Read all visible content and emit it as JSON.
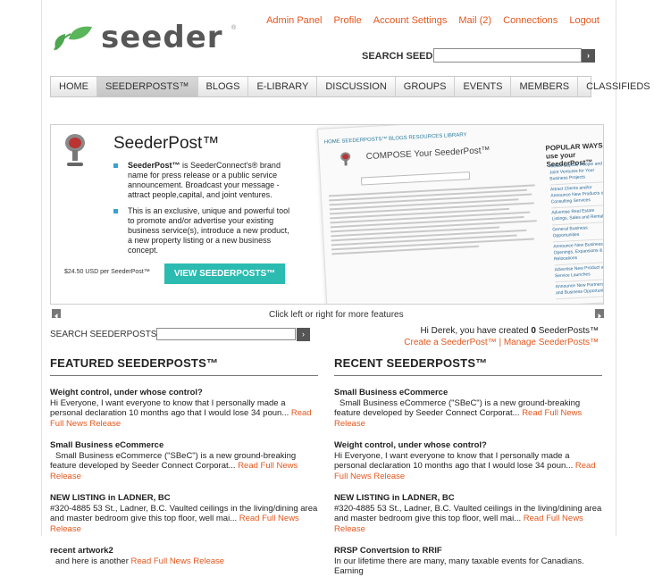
{
  "top_links": [
    "Admin Panel",
    "Profile",
    "Account Settings",
    "Mail (2)",
    "Connections",
    "Logout"
  ],
  "logo": {
    "text": "seeder",
    "reg": "®"
  },
  "search_top": {
    "label": "SEARCH SEEDER:",
    "button": "›"
  },
  "nav": [
    "HOME",
    "SEEDERPOSTS™",
    "BLOGS",
    "E-LIBRARY",
    "DISCUSSION",
    "GROUPS",
    "EVENTS",
    "MEMBERS",
    "CLASSIFIEDS"
  ],
  "banner": {
    "title": "SeederPost™",
    "bullet1_bold": "SeederPost™",
    "bullet1_rest": " is SeederConnect's® brand name for press release or a public service announcement. Broadcast your message - attract people,capital, and joint ventures.",
    "bullet2": "This is an exclusive, unique and powerful tool to promote and/or advertise your existing business service(s), introduce a new product, a new property listing or a new business concept.",
    "price": "$24.50 USD per SeederPost™",
    "button": "VIEW SEEDERPOSTS™",
    "preview_compose": "COMPOSE Your SeederPost™",
    "preview_popular": "POPULAR WAYS to use your SeederPost™",
    "preview_nav": "HOME   SEEDERPOSTS™   BLOGS   RESOURCES   LIBRARY",
    "preview_items": [
      "Attract Capital, People and Joint Ventures for Your Business Projects",
      "Attract Clients and/or Announce New Products or Consulting Services",
      "Advertise Real Estate Listings, Sales and Rentals",
      "General Business Opportunities",
      "Announce New Business Openings, Expansions & Relocations",
      "Advertise New Product and Service Launches",
      "Announce New Partnerships and Business Opportunities"
    ]
  },
  "click_note": "Click left or right for more features",
  "search2": {
    "label": "SEARCH SEEDERPOSTS:",
    "button": "›"
  },
  "created": {
    "prefix": "Hi Derek, you have created ",
    "count": "0",
    "suffix": " SeederPosts™",
    "link1": "Create a SeederPost™",
    "sep": " | ",
    "link2": "Manage SeederPosts™"
  },
  "featured": {
    "heading": "FEATURED SEEDERPOSTS™",
    "items": [
      {
        "title": "Weight control, under whose control?",
        "text": "Hi Everyone, I want everyone to know that I personally made a personal declaration 10 months ago that I would lose 34 poun... ",
        "link": "Read Full News Release"
      },
      {
        "title": "Small Business eCommerce",
        "text": "Small Business eCommerce (\"SBeC\") is a new ground-breaking feature developed by Seeder Connect Corporat... ",
        "link": "Read Full News Release"
      },
      {
        "title": "NEW LISTING in LADNER, BC",
        "text": "#320-4885 53 St., Ladner, B.C. Vaulted ceilings in the living/dining area and master bedroom give this top floor, well mai... ",
        "link": "Read Full News Release"
      },
      {
        "title": "recent artwork2",
        "text": "and here is another ",
        "link": "Read Full News Release"
      }
    ]
  },
  "recent": {
    "heading": "RECENT SEEDERPOSTS™",
    "items": [
      {
        "title": "Small Business eCommerce",
        "text": "Small Business eCommerce (\"SBeC\") is a new ground-breaking feature developed by Seeder Connect Corporat... ",
        "link": "Read Full News Release"
      },
      {
        "title": "Weight control, under whose control?",
        "text": "Hi Everyone, I want everyone to know that I personally made a personal declaration 10 months ago that I would lose 34 poun... ",
        "link": "Read Full News Release"
      },
      {
        "title": "NEW LISTING in LADNER, BC",
        "text": "#320-4885 53 St., Ladner, B.C. Vaulted ceilings in the living/dining area and master bedroom give this top floor, well mai... ",
        "link": "Read Full News Release"
      },
      {
        "title": "RRSP Convertsion to RRIF",
        "text": "In our lifetime there are many, many taxable events for Canadians. Earning",
        "link": ""
      }
    ]
  },
  "colors": {
    "accent_orange": "#e2571e",
    "teal_button": "#2bbbb0",
    "bullet_blue": "#3aa0d0",
    "logo_green": "#4ea64e"
  }
}
